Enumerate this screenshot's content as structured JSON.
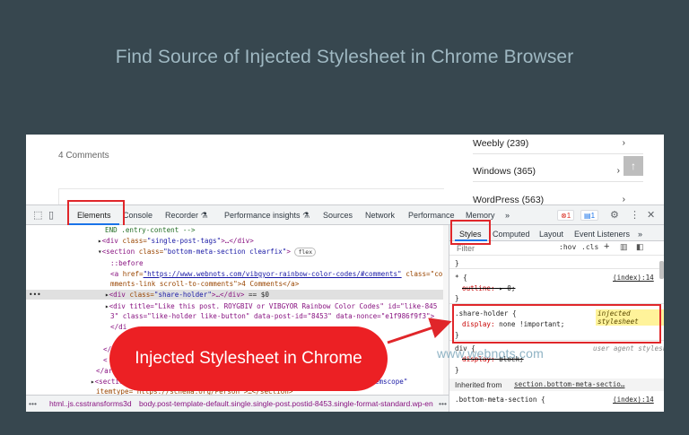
{
  "title": "Find Source of Injected Stylesheet in Chrome Browser",
  "page": {
    "comments": "4 Comments",
    "categories": [
      {
        "label": "Weebly (239)"
      },
      {
        "label": "Windows (365)"
      },
      {
        "label": "WordPress (563)"
      }
    ],
    "back_to_top": "↑"
  },
  "devtools": {
    "tabs": [
      "Elements",
      "Console",
      "Recorder ⚗",
      "Performance insights ⚗",
      "Sources",
      "Network",
      "Performance",
      "Memory",
      "»"
    ],
    "error_count": "1",
    "message_count": "1",
    "elements_lines": {
      "l1": "END .entry-content -->",
      "l2_tag": "<div",
      "l2_attr": " class=",
      "l2_val": "\"single-post-tags\"",
      "l2_end": ">…</div>",
      "l3_tag": "<section",
      "l3_attr": " class=",
      "l3_val": "\"bottom-meta-section clearfix\"",
      "l3_end": ">",
      "l3_badge": "flex",
      "l4": "::before",
      "l5_tag": "<a",
      "l5_attr": " href=",
      "l5_link": "\"https://www.webnots.com/vibgyor-rainbow-color-codes/#comments\"",
      "l5_attr2": " class=\"co",
      "l6": "mments-link scroll-to-comments\">4 Comments</a>",
      "l7_tag": "<div",
      "l7_attr": " class=",
      "l7_val": "\"share-holder\"",
      "l7_end": ">…</div>",
      "l7_eq": " == $0",
      "l8": "<div title=\"Like this post. ROYGBIV or VIBGYOR Rainbow Color Codes\" id=\"like-845",
      "l9": "3\" class=\"like-holder like-button\" data-post-id=\"8453\" data-nonce=\"e1f986f9f3\">",
      "l10": "</di",
      "l11": "</",
      "l12": "<",
      "l13": "</ar",
      "l14": "<section",
      "l14_end": " itemscope\"",
      "l15": "itemtype=\"https://schema.org/Person\">…</section>"
    },
    "styles_tabs": [
      "Styles",
      "Computed",
      "Layout",
      "Event Listeners",
      "»"
    ],
    "filter_placeholder": "Filter",
    "filter_actions": [
      ":hov",
      ".cls",
      "+"
    ],
    "rules": {
      "r0": "}",
      "r1_sel": "* {",
      "r1_src": "(index):14",
      "r1_prop": "outline:",
      "r1_val": "▸ 0;",
      "r1_end": "}",
      "r2_sel": ".share-holder {",
      "r2_badge": "injected stylesheet",
      "r2_prop": "display:",
      "r2_val": "none !important;",
      "r2_end": "}",
      "r3_sel": "div {",
      "r3_src": "user agent stylesheet",
      "r3_prop": "display:",
      "r3_val": "block;",
      "r3_end": "}",
      "inherited_label": "Inherited from",
      "inherited_from": "section.bottom-meta-sectio…",
      "r4_sel": ".bottom-meta-section {",
      "r4_src": "(index):14"
    },
    "breadcrumb": [
      "html..js.csstransforms3d",
      "body.post-template-default.single.single-post.postid-8453.single-format-standard.wp-en"
    ]
  },
  "callout": "Injected Stylesheet in Chrome",
  "watermark": "www.webnots.com",
  "colors": {
    "highlight": "#e0262a",
    "callout": "#ec2024",
    "background": "#37474f",
    "title": "#9fb8c2"
  }
}
